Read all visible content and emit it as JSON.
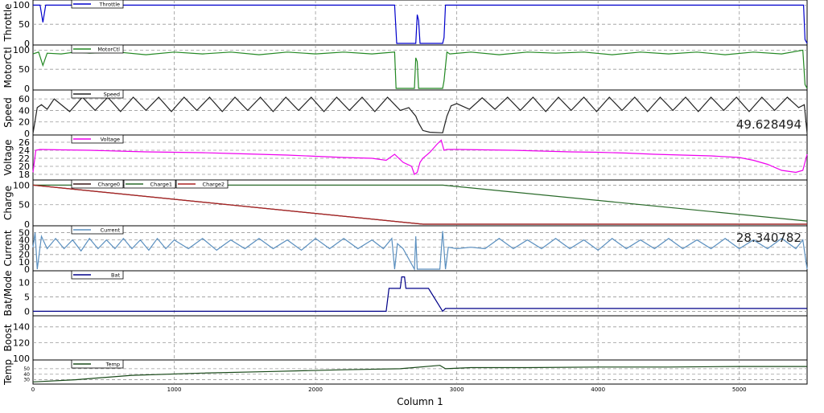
{
  "chart_data": {
    "type": "line",
    "xlabel": "Column 1",
    "xlim": [
      0,
      5480
    ],
    "xticks": [
      0,
      1000,
      2000,
      3000,
      4000,
      5000
    ],
    "grid": true,
    "legend_position": "top-left",
    "panels": [
      {
        "ylabel": "Throttle",
        "ylim": [
          0,
          105
        ],
        "yticks": [
          0,
          50,
          100
        ],
        "series": [
          {
            "name": "Throttle",
            "color": "#0000cc",
            "x": [
              0,
              50,
              70,
              90,
              100,
              2560,
              2575,
              2590,
              2600,
              2700,
              2710,
              2720,
              2730,
              2740,
              2750,
              2790,
              2900,
              2910,
              2920,
              2930,
              5455,
              5465,
              5480
            ],
            "y": [
              100,
              100,
              55,
              100,
              100,
              100,
              0,
              0,
              0,
              0,
              0,
              75,
              60,
              0,
              0,
              0,
              0,
              15,
              100,
              100,
              100,
              10,
              0
            ]
          }
        ]
      },
      {
        "ylabel": "MotorCtl",
        "ylim": [
          0,
          105
        ],
        "yticks": [
          0,
          50,
          100
        ],
        "series": [
          {
            "name": "MotorCtl",
            "color": "#228822",
            "x": [
              0,
              40,
              70,
              100,
              200,
              300,
              400,
              600,
              800,
              1000,
              1200,
              1400,
              1600,
              1800,
              2000,
              2200,
              2400,
              2560,
              2570,
              2580,
              2700,
              2710,
              2720,
              2730,
              2750,
              2900,
              2910,
              2930,
              2950,
              3100,
              3300,
              3500,
              3700,
              3900,
              4100,
              4300,
              4500,
              4700,
              4900,
              5100,
              5300,
              5450,
              5465,
              5480
            ],
            "y": [
              90,
              95,
              60,
              92,
              90,
              95,
              92,
              95,
              88,
              95,
              90,
              95,
              88,
              95,
              90,
              95,
              90,
              95,
              0,
              0,
              0,
              80,
              70,
              0,
              0,
              0,
              20,
              95,
              90,
              95,
              88,
              95,
              92,
              95,
              88,
              95,
              90,
              95,
              88,
              95,
              90,
              100,
              10,
              0
            ]
          }
        ]
      },
      {
        "ylabel": "Speed",
        "ylim": [
          0,
          70
        ],
        "yticks": [
          0,
          20,
          40,
          60
        ],
        "readout": "49.628494",
        "series": [
          {
            "name": "Speed",
            "color": "#222222",
            "x": [
              0,
              30,
              60,
              100,
              150,
              260,
              350,
              440,
              530,
              620,
              710,
              800,
              890,
              980,
              1070,
              1160,
              1250,
              1340,
              1430,
              1520,
              1610,
              1700,
              1790,
              1880,
              1970,
              2060,
              2150,
              2240,
              2330,
              2420,
              2510,
              2600,
              2660,
              2710,
              2730,
              2760,
              2810,
              2900,
              2930,
              2960,
              3000,
              3090,
              3180,
              3270,
              3360,
              3450,
              3540,
              3630,
              3720,
              3810,
              3900,
              3990,
              4080,
              4170,
              4260,
              4350,
              4440,
              4530,
              4620,
              4710,
              4800,
              4890,
              4980,
              5070,
              5160,
              5250,
              5340,
              5420,
              5460,
              5480
            ],
            "y": [
              0,
              45,
              50,
              42,
              60,
              38,
              63,
              40,
              63,
              38,
              63,
              40,
              63,
              38,
              63,
              40,
              63,
              38,
              63,
              40,
              63,
              38,
              63,
              40,
              63,
              38,
              63,
              40,
              63,
              38,
              63,
              40,
              45,
              30,
              18,
              5,
              2,
              1,
              30,
              48,
              52,
              42,
              62,
              42,
              63,
              40,
              63,
              38,
              63,
              40,
              63,
              38,
              63,
              40,
              63,
              38,
              63,
              40,
              63,
              38,
              63,
              40,
              63,
              38,
              63,
              40,
              63,
              45,
              50,
              0
            ]
          }
        ]
      },
      {
        "ylabel": "Voltage",
        "ylim": [
          17,
          27
        ],
        "yticks": [
          18,
          20,
          22,
          24,
          26
        ],
        "series": [
          {
            "name": "Voltage",
            "color": "#ee00ee",
            "x": [
              0,
              20,
              50,
              200,
              400,
              600,
              800,
              1000,
              1200,
              1400,
              1600,
              1800,
              2000,
              2200,
              2400,
              2500,
              2560,
              2620,
              2680,
              2700,
              2720,
              2740,
              2760,
              2810,
              2860,
              2890,
              2910,
              2930,
              3000,
              3200,
              3400,
              3600,
              3800,
              4000,
              4200,
              4400,
              4600,
              4800,
              5000,
              5100,
              5200,
              5300,
              5400,
              5450,
              5480
            ],
            "y": [
              18.5,
              24,
              24.2,
              24.1,
              24,
              23.8,
              23.6,
              23.5,
              23.4,
              23.2,
              23,
              22.8,
              22.5,
              22.2,
              22,
              21.5,
              23,
              21,
              20,
              18,
              18.5,
              21,
              22,
              23.5,
              25.5,
              26.5,
              24,
              24.2,
              24.2,
              24.1,
              24,
              23.8,
              23.6,
              23.5,
              23.3,
              23,
              22.8,
              22.6,
              22.2,
              21.5,
              20.5,
              19,
              18.5,
              19,
              23
            ]
          }
        ]
      },
      {
        "ylabel": "Charge",
        "ylim": [
          0,
          105
        ],
        "yticks": [
          0,
          50,
          100
        ],
        "series": [
          {
            "name": "Charge0",
            "color": "#3a1a1a",
            "x": [
              0,
              2760,
              5480
            ],
            "y": [
              100,
              0,
              0
            ]
          },
          {
            "name": "Charge1",
            "color": "#2a6a2a",
            "x": [
              0,
              2900,
              5480
            ],
            "y": [
              100,
              100,
              8
            ]
          },
          {
            "name": "Charge2",
            "color": "#aa2222",
            "x": [
              0,
              2760,
              5480
            ],
            "y": [
              100,
              0,
              0
            ]
          }
        ]
      },
      {
        "ylabel": "Current",
        "ylim": [
          0,
          55
        ],
        "yticks": [
          0,
          10,
          20,
          30,
          40,
          50
        ],
        "readout": "28.340782",
        "series": [
          {
            "name": "Current",
            "color": "#5a8fbf",
            "x": [
              0,
              15,
              30,
              60,
              100,
              160,
              220,
              280,
              340,
              400,
              460,
              520,
              580,
              640,
              700,
              760,
              820,
              880,
              940,
              1000,
              1100,
              1200,
              1300,
              1400,
              1500,
              1600,
              1700,
              1800,
              1900,
              2000,
              2100,
              2200,
              2300,
              2400,
              2480,
              2540,
              2560,
              2580,
              2620,
              2700,
              2710,
              2720,
              2740,
              2780,
              2880,
              2900,
              2920,
              2940,
              3000,
              3100,
              3200,
              3300,
              3400,
              3500,
              3600,
              3700,
              3800,
              3900,
              4000,
              4100,
              4200,
              4300,
              4400,
              4500,
              4600,
              4700,
              4800,
              4900,
              5000,
              5100,
              5200,
              5300,
              5400,
              5450,
              5480
            ],
            "y": [
              30,
              50,
              0,
              45,
              28,
              42,
              28,
              40,
              25,
              42,
              28,
              40,
              28,
              42,
              28,
              40,
              26,
              42,
              28,
              40,
              28,
              42,
              26,
              40,
              28,
              42,
              28,
              40,
              26,
              42,
              28,
              42,
              28,
              40,
              28,
              42,
              0,
              35,
              28,
              0,
              45,
              0,
              0,
              0,
              0,
              52,
              0,
              30,
              28,
              30,
              28,
              42,
              28,
              40,
              28,
              42,
              28,
              40,
              26,
              42,
              28,
              40,
              28,
              42,
              28,
              40,
              28,
              42,
              28,
              40,
              28,
              42,
              28,
              40,
              0
            ]
          }
        ]
      },
      {
        "ylabel": "Bat/Mode",
        "ylim": [
          -1,
          13
        ],
        "yticks": [
          0,
          5,
          10
        ],
        "series": [
          {
            "name": "Bat",
            "color": "#000088",
            "x": [
              0,
              2500,
              2520,
              2600,
              2610,
              2630,
              2640,
              2800,
              2900,
              2920,
              5480
            ],
            "y": [
              0,
              0,
              8,
              8,
              12,
              12,
              8,
              8,
              0,
              1,
              1
            ]
          }
        ]
      },
      {
        "ylabel": "Boost",
        "ylim": [
          100,
          150
        ],
        "yticks": [
          100,
          120,
          140
        ],
        "series": []
      },
      {
        "ylabel": "Temp",
        "ylim": [
          25,
          60
        ],
        "yticks": [
          30,
          40,
          50
        ],
        "series": [
          {
            "name": "Temp",
            "color": "#1a4a1a",
            "x": [
              0,
              300,
              700,
              1200,
              1700,
              2200,
              2600,
              2880,
              2920,
              3100,
              3500,
              4000,
              4500,
              5000,
              5480
            ],
            "y": [
              26,
              30,
              38,
              42,
              45,
              48,
              50,
              56,
              50,
              52,
              52,
              53,
              53,
              54,
              54
            ]
          }
        ]
      }
    ]
  }
}
